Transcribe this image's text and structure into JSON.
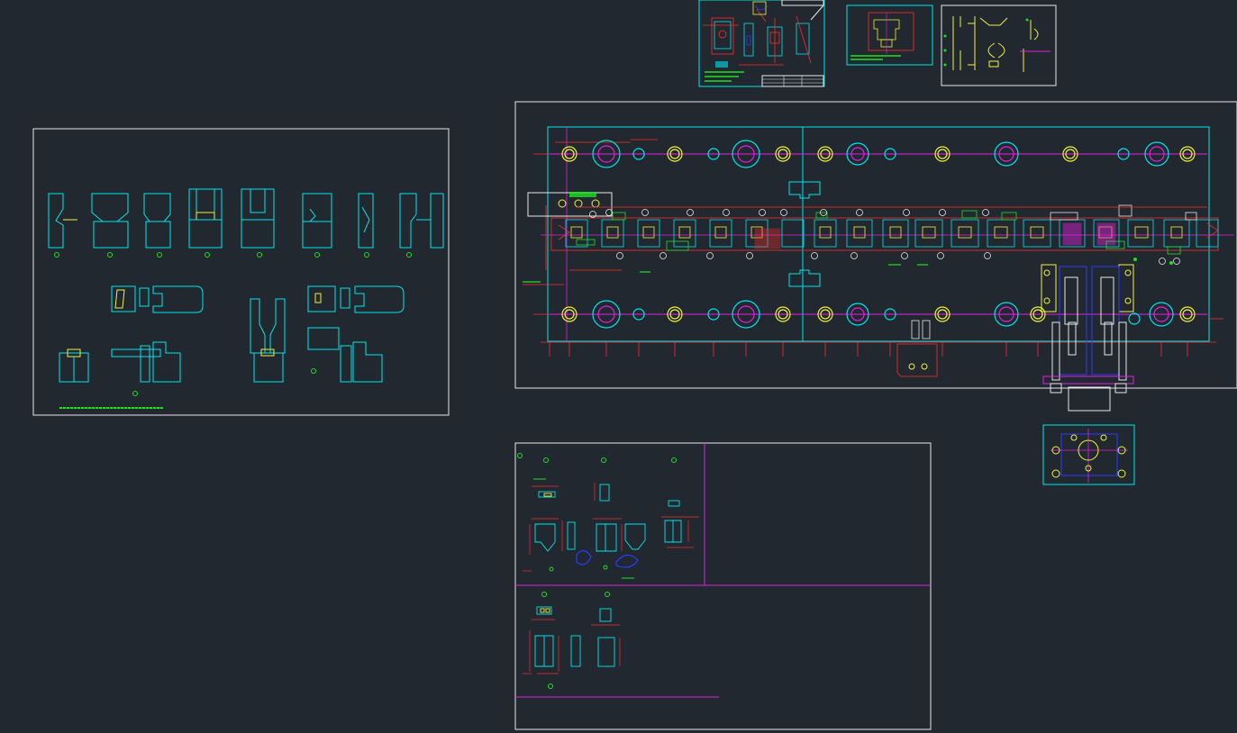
{
  "canvas": {
    "background": "#212830",
    "colors": {
      "white": "#e8e8e8",
      "cyan": "#00e5ee",
      "red": "#ff2b2b",
      "magenta": "#e020e0",
      "yellow": "#f2f23a",
      "green": "#20e020",
      "blue": "#2b3cff"
    }
  },
  "sheets": [
    {
      "id": "bending-stages-sheet",
      "label": ""
    },
    {
      "id": "main-strip-layout-sheet",
      "label": ""
    },
    {
      "id": "detail-sheet-top-1",
      "label": ""
    },
    {
      "id": "detail-sheet-top-2",
      "label": ""
    },
    {
      "id": "detail-sheet-top-3",
      "label": ""
    },
    {
      "id": "parts-detail-sheet",
      "label": ""
    },
    {
      "id": "punch-plate-detail",
      "label": ""
    }
  ]
}
